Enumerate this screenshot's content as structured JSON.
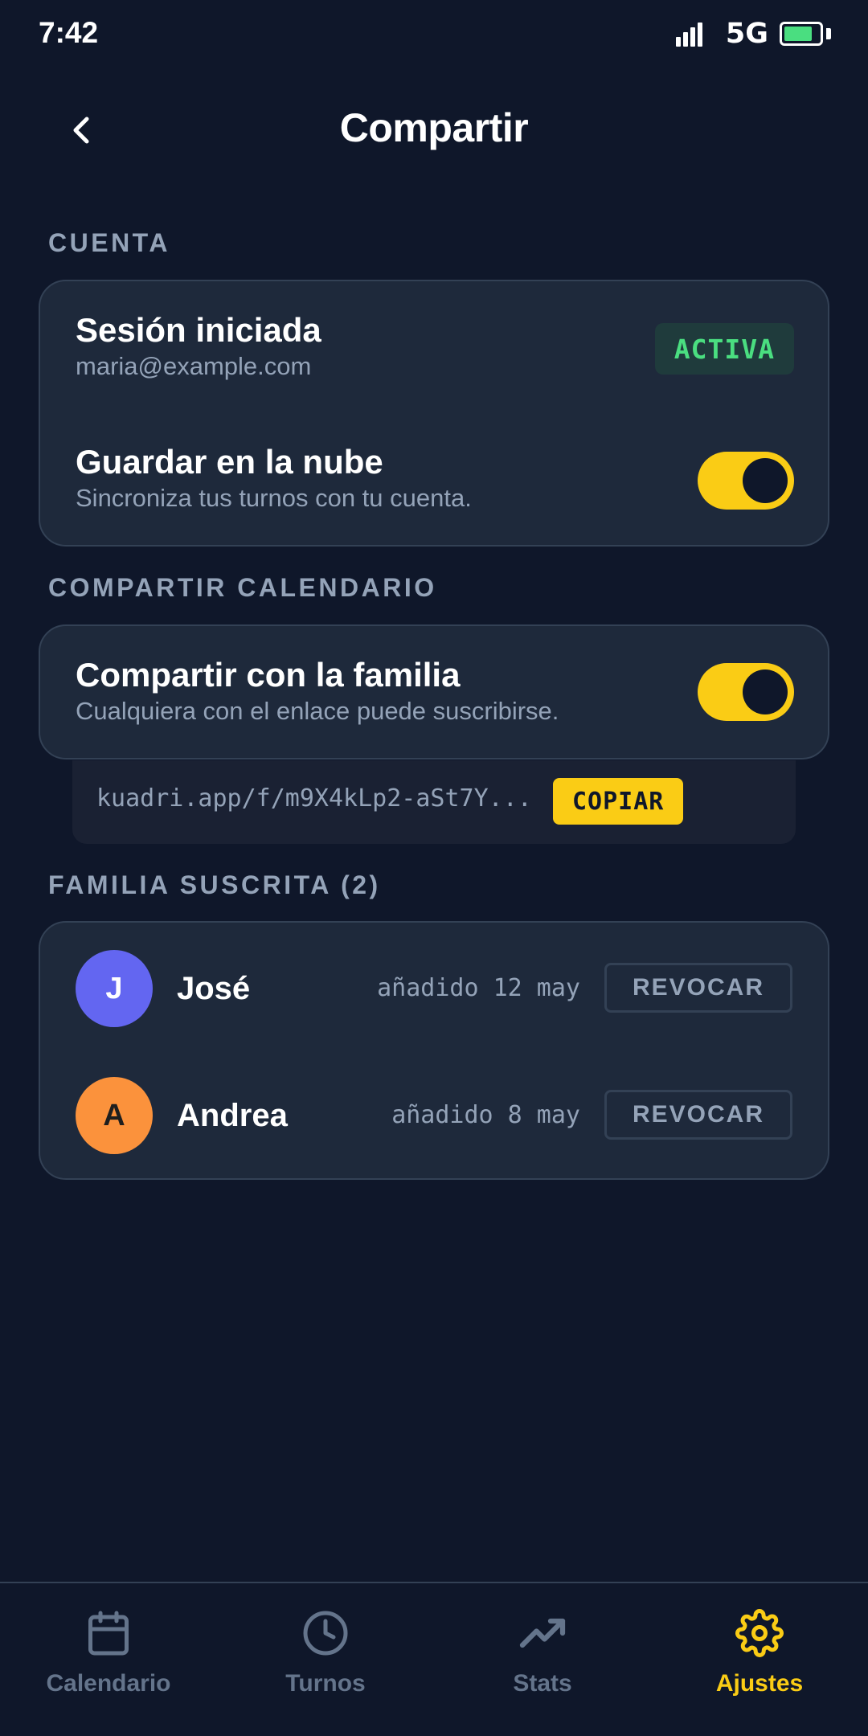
{
  "status_bar": {
    "time": "7:42",
    "network": "5G",
    "battery_level": 0.8
  },
  "header": {
    "title": "Compartir"
  },
  "account": {
    "section_label": "CUENTA",
    "session_title": "Sesión iniciada",
    "email": "maria@example.com",
    "status_badge": "ACTIVA",
    "cloud_title": "Guardar en la nube",
    "cloud_sub": "Sincroniza tus turnos con tu cuenta.",
    "cloud_enabled": true
  },
  "share": {
    "section_label": "COMPARTIR CALENDARIO",
    "family_title": "Compartir con la familia",
    "family_sub": "Cualquiera con el enlace puede suscribirse.",
    "family_enabled": true,
    "link": "kuadri.app/f/m9X4kLp2-aSt7Y...",
    "copy_label": "COPIAR"
  },
  "family": {
    "section_label": "FAMILIA SUSCRITA (2)",
    "members": [
      {
        "initial": "J",
        "name": "José",
        "added": "añadido 12 may",
        "action": "REVOCAR",
        "color": "#6366f1",
        "initial_color": "#ffffff"
      },
      {
        "initial": "A",
        "name": "Andrea",
        "added": "añadido 8 may",
        "action": "REVOCAR",
        "color": "#fb923c",
        "initial_color": "#1e1e1e"
      }
    ]
  },
  "nav": {
    "items": [
      {
        "label": "Calendario",
        "icon": "calendar-icon"
      },
      {
        "label": "Turnos",
        "icon": "clock-icon"
      },
      {
        "label": "Stats",
        "icon": "trending-up-icon"
      },
      {
        "label": "Ajustes",
        "icon": "gear-icon"
      }
    ],
    "active": "Ajustes"
  },
  "colors": {
    "background": "#0f172a",
    "card": "#1e293b",
    "accent": "#facc15",
    "success": "#4ade80"
  }
}
